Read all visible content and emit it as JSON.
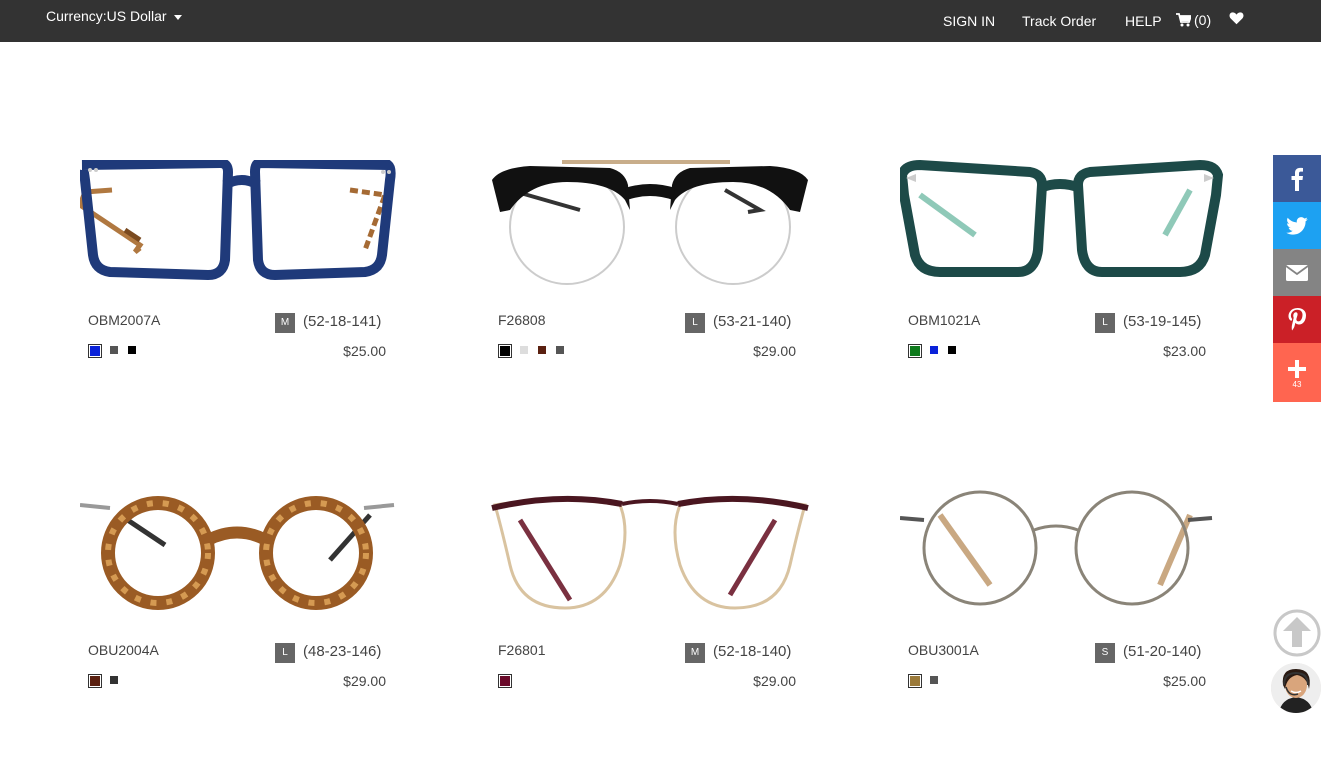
{
  "topbar": {
    "currency_label": "Currency:US Dollar",
    "sign_in": "SIGN IN",
    "track_order": "Track Order",
    "help": "HELP",
    "cart_count": "(0)"
  },
  "products": [
    {
      "code": "OBM2007A",
      "size": "M",
      "dims": "(52-18-141)",
      "price": "$25.00",
      "swatches": [
        {
          "color": "#0a22d9",
          "selected": true
        },
        {
          "color": "#555555",
          "selected": false
        },
        {
          "color": "#000000",
          "selected": false
        }
      ]
    },
    {
      "code": "F26808",
      "size": "L",
      "dims": "(53-21-140)",
      "price": "$29.00",
      "swatches": [
        {
          "color": "#000000",
          "selected": true
        },
        {
          "color": "#dddddd",
          "selected": false
        },
        {
          "color": "#5a2010",
          "selected": false
        },
        {
          "color": "#555555",
          "selected": false
        }
      ]
    },
    {
      "code": "OBM1021A",
      "size": "L",
      "dims": "(53-19-145)",
      "price": "$23.00",
      "swatches": [
        {
          "color": "#0e7a1c",
          "selected": true
        },
        {
          "color": "#0a22d9",
          "selected": false
        },
        {
          "color": "#000000",
          "selected": false
        }
      ]
    },
    {
      "code": "OBU2004A",
      "size": "L",
      "dims": "(48-23-146)",
      "price": "$29.00",
      "swatches": [
        {
          "color": "#5a2010",
          "selected": true
        },
        {
          "color": "#333333",
          "selected": false
        }
      ]
    },
    {
      "code": "F26801",
      "size": "M",
      "dims": "(52-18-140)",
      "price": "$29.00",
      "swatches": [
        {
          "color": "#6a0a2a",
          "selected": true
        }
      ]
    },
    {
      "code": "OBU3001A",
      "size": "S",
      "dims": "(51-20-140)",
      "price": "$25.00",
      "swatches": [
        {
          "color": "#9b7a3a",
          "selected": true
        },
        {
          "color": "#555555",
          "selected": false
        }
      ]
    }
  ],
  "share": {
    "facebook_color": "#3b5998",
    "twitter_color": "#1da1f2",
    "email_color": "#848484",
    "pinterest_color": "#cb2027",
    "more_color": "#ff6550",
    "more_count": "43"
  }
}
